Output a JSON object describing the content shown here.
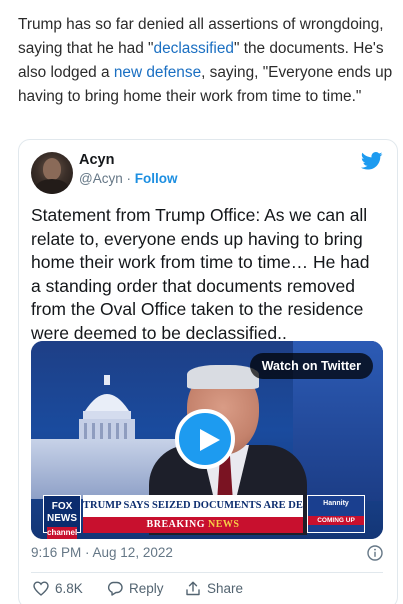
{
  "article": {
    "part1": "Trump has so far denied all assertions of wrongdoing, saying that he had \"",
    "link1": "declassified",
    "part2": "\" the documents. He's also lodged a ",
    "link2": "new defense",
    "part3": ", saying, \"Everyone ends up having to bring home their work from time to time.\""
  },
  "tweet": {
    "author_name": "Acyn",
    "handle": "@Acyn",
    "separator": "·",
    "follow_label": "Follow",
    "text": "Statement from Trump Office: As we can all relate to, everyone ends up having to bring home their work from time to time… He had a standing order that documents removed from the Oval Office taken to the residence were deemed to be declassified..",
    "media": {
      "watch_label": "Watch on Twitter",
      "logo_line1": "FOX",
      "logo_line2": "NEWS",
      "logo_tag": "channel",
      "headline": "TRUMP SAYS SEIZED DOCUMENTS ARE DECLASSIFIED",
      "breaking_a": "BREAKING ",
      "breaking_b": "NEWS",
      "promo_title": "Hannity",
      "promo_tag": "COMING UP"
    },
    "timestamp": "9:16 PM · Aug 12, 2022",
    "actions": {
      "likes": "6.8K",
      "reply_label": "Reply",
      "share_label": "Share"
    }
  },
  "colors": {
    "twitter_blue": "#1d9bf0",
    "link_blue": "#1a6fc2",
    "fox_red": "#c8102e",
    "fox_navy": "#0b2c6e"
  },
  "icons": [
    "twitter-bird-icon",
    "play-icon",
    "info-icon",
    "heart-icon",
    "reply-icon",
    "share-icon"
  ]
}
